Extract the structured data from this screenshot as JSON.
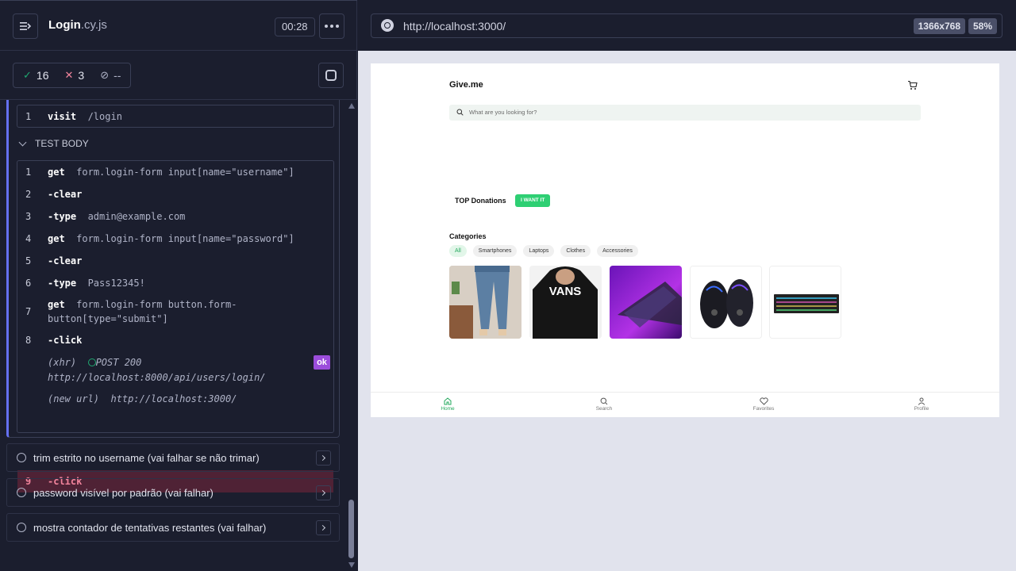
{
  "header": {
    "spec_name": "Login",
    "spec_ext": ".cy.js",
    "timer": "00:28"
  },
  "stats": {
    "passed": "16",
    "failed": "3",
    "pending": "--"
  },
  "current_test": {
    "before_each": [
      {
        "num": "1",
        "name": "visit",
        "message": "/login"
      }
    ],
    "section_label": "TEST BODY",
    "commands": [
      {
        "num": "1",
        "name": "get",
        "message": "form.login-form input[name=\"username\"]"
      },
      {
        "num": "2",
        "name": "-clear",
        "message": ""
      },
      {
        "num": "3",
        "name": "-type",
        "message": "admin@example.com"
      },
      {
        "num": "4",
        "name": "get",
        "message": "form.login-form input[name=\"password\"]"
      },
      {
        "num": "5",
        "name": "-clear",
        "message": ""
      },
      {
        "num": "6",
        "name": "-type",
        "message": "Pass12345!"
      },
      {
        "num": "7",
        "name": "get",
        "message": "form.login-form button.form-",
        "message2": "button[type=\"submit\"]"
      },
      {
        "num": "8",
        "name": "-click",
        "message": ""
      },
      {
        "num": "9",
        "name": "-click",
        "message": ""
      }
    ],
    "xhr": {
      "label": "(xhr)",
      "method": "POST 200",
      "url": "http://localhost:8000/api/users/login/",
      "badge": "ok"
    },
    "new_url": {
      "label": "(new url)",
      "url": "http://localhost:3000/"
    }
  },
  "tests": [
    {
      "title": "trim estrito no username (vai falhar se não trimar)"
    },
    {
      "title": "password visível por padrão (vai falhar)"
    },
    {
      "title": "mostra contador de tentativas restantes (vai falhar)"
    }
  ],
  "browser": {
    "url": "http://localhost:3000/",
    "viewport": "1366x768",
    "zoom": "58%"
  },
  "app": {
    "logo": "Give.me",
    "search_placeholder": "What are you looking for?",
    "top_donations": "TOP Donations",
    "want_button": "I WANT IT",
    "categories_title": "Categories",
    "categories": [
      "All",
      "Smartphones",
      "Laptops",
      "Clothes",
      "Accessories"
    ],
    "active_category": "All",
    "products": [
      "jeans-image",
      "hoodie-image",
      "laptop-image",
      "mouse-image",
      "keyboard-image"
    ],
    "hoodie_brand": "VANS",
    "nav": [
      {
        "label": "Home",
        "icon": "home-icon",
        "active": true
      },
      {
        "label": "Search",
        "icon": "search-icon",
        "active": false
      },
      {
        "label": "Favorites",
        "icon": "heart-icon",
        "active": false
      },
      {
        "label": "Profile",
        "icon": "user-icon",
        "active": false
      }
    ]
  },
  "colors": {
    "accent": "#6470f3",
    "passed": "#1fa971",
    "failed": "#f2849c",
    "failed_row_bg": "#4f2235",
    "app_green": "#2ecf73"
  }
}
